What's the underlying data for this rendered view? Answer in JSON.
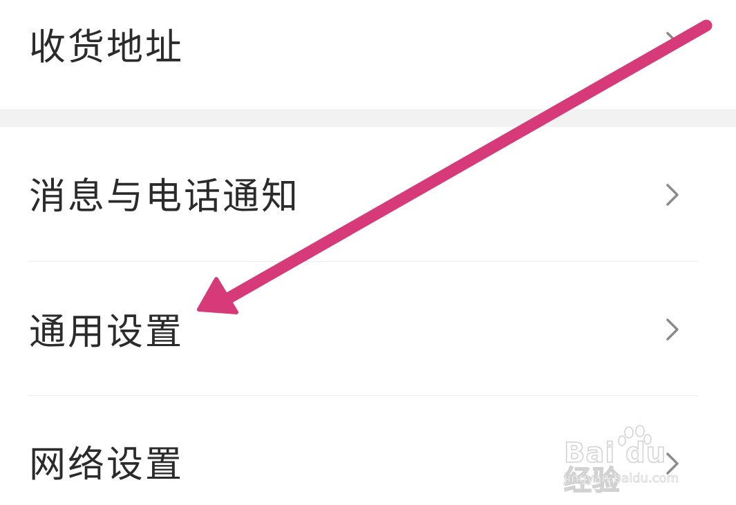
{
  "settings": {
    "items": [
      {
        "label": "收货地址"
      },
      {
        "label": "消息与电话通知"
      },
      {
        "label": "通用设置"
      },
      {
        "label": "网络设置"
      }
    ]
  },
  "annotation": {
    "arrow_color": "#d63a78",
    "target": "通用设置"
  },
  "watermark": {
    "brand": "Bai du 经验",
    "url": "jingyan.baidu.com"
  },
  "colors": {
    "background": "#ffffff",
    "section_gap": "#f2f2f2",
    "text": "#2b2b2b",
    "chevron": "#8a8a8a",
    "divider": "#ececec"
  }
}
